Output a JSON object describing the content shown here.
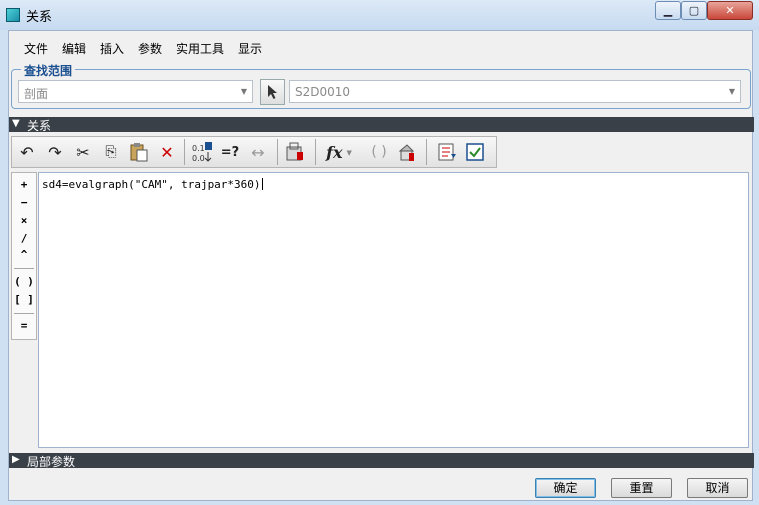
{
  "window": {
    "title": "关系"
  },
  "menu": [
    "文件",
    "编辑",
    "插入",
    "参数",
    "实用工具",
    "显示"
  ],
  "search_scope": {
    "title": "查找范围",
    "type_value": "剖面",
    "item_value": "S2D0010"
  },
  "relations_section": {
    "label": "关系"
  },
  "toolbar": [
    {
      "name": "undo-icon",
      "glyph": "↶"
    },
    {
      "name": "redo-icon",
      "glyph": "↷"
    },
    {
      "name": "cut-icon",
      "glyph": "✂"
    },
    {
      "name": "copy-icon",
      "glyph": "⎘"
    },
    {
      "name": "paste-icon",
      "glyph": "📋"
    },
    {
      "name": "delete-icon",
      "glyph": "✕"
    },
    {
      "name": "sort-icon",
      "glyph": "⇅"
    },
    {
      "name": "evaluate-icon",
      "glyph": "=?"
    },
    {
      "name": "dimension-icon",
      "glyph": "↔"
    },
    {
      "name": "verify-icon",
      "glyph": "🔒"
    },
    {
      "name": "function-icon",
      "glyph": "fx"
    },
    {
      "name": "brackets-icon",
      "glyph": "( )"
    },
    {
      "name": "parameter-icon",
      "glyph": "🔑"
    },
    {
      "name": "units-icon",
      "glyph": "☰"
    },
    {
      "name": "check-icon",
      "glyph": "☑"
    }
  ],
  "operators": [
    "+",
    "−",
    "×",
    "/",
    "^",
    "( )",
    "[ ]",
    "="
  ],
  "editor": {
    "text": "sd4=evalgraph(\"CAM\", trajpar*360)"
  },
  "local_params_section": {
    "label": "局部参数"
  },
  "buttons": {
    "ok": "确定",
    "reset": "重置",
    "cancel": "取消"
  },
  "colors": {
    "section_bar": "#3a4047",
    "group_title": "#1b4f8f",
    "window_bg": "#cfe0f3"
  }
}
